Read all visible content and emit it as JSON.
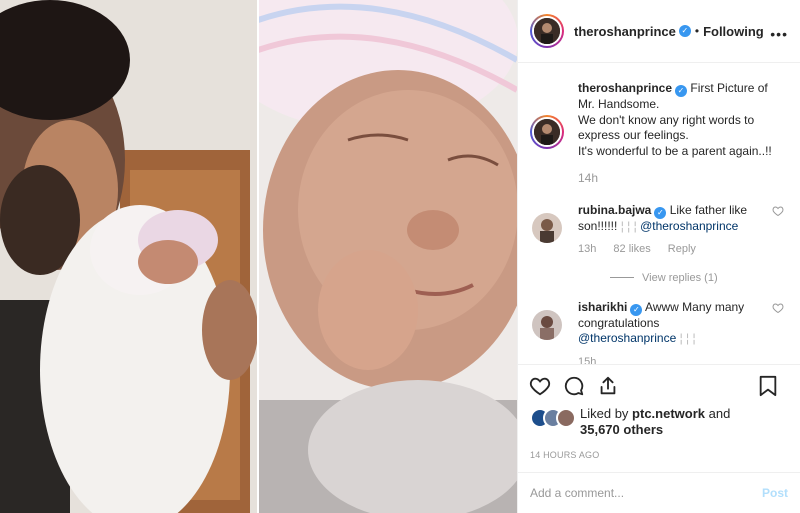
{
  "post": {
    "username": "theroshanprince",
    "follow_separator": "•",
    "follow_status": "Following",
    "caption_lines": [
      "First Picture of",
      "Mr. Handsome.",
      "We don't know any right words to",
      "express our feelings.",
      "It's wonderful to be a parent again..!!"
    ],
    "caption_age": "14h"
  },
  "comments": [
    {
      "username": "rubina.bajwa",
      "text": "Like father like son!!!!!! ",
      "emoji_glyph": "¦ ¦ ¦",
      "mention": "@theroshanprince",
      "age": "13h",
      "likes": "82 likes",
      "reply": "Reply",
      "view_replies": "View replies (1)"
    },
    {
      "username": "isharikhi",
      "text": "Awww Many many congratulations",
      "mention": "@theroshanprince",
      "emoji_glyph": "¦ ¦ ¦",
      "age": "15h"
    }
  ],
  "likes": {
    "prefix": "Liked by",
    "liker": "ptc.network",
    "conj": "and",
    "others": "35,670 others"
  },
  "timestamp": "14 HOURS AGO",
  "add_comment": {
    "placeholder": "Add a comment...",
    "post_label": "Post"
  },
  "icons": {
    "verified": "verified-badge-icon",
    "like": "heart-icon",
    "comment": "comment-bubble-icon",
    "share": "share-arrow-icon",
    "save": "bookmark-icon"
  },
  "colors": {
    "verified_blue": "#3897f0",
    "muted": "#999999",
    "post_btn": "#b2dffc",
    "mention": "#003569"
  }
}
